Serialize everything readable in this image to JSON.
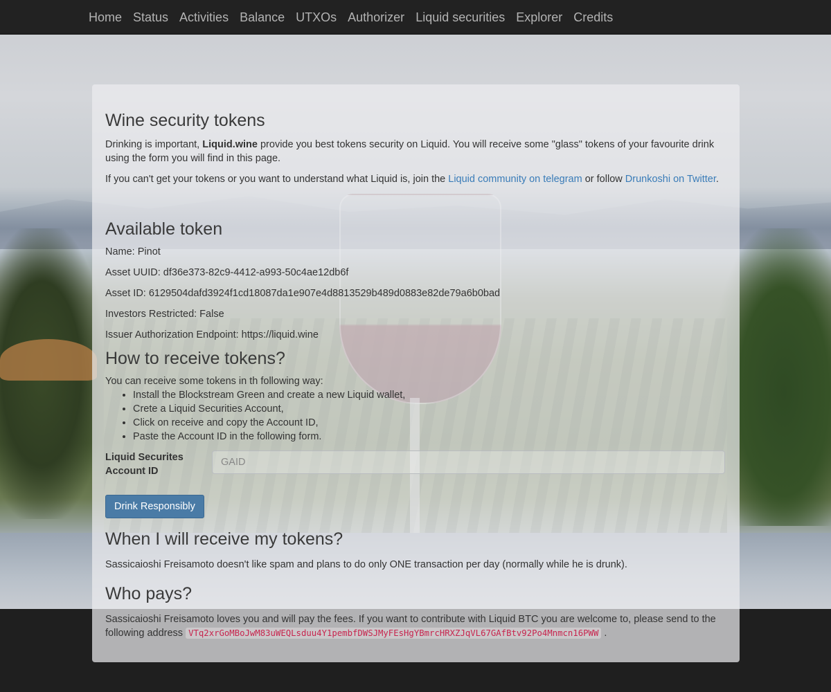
{
  "nav": {
    "items": [
      {
        "label": "Home"
      },
      {
        "label": "Status"
      },
      {
        "label": "Activities"
      },
      {
        "label": "Balance"
      },
      {
        "label": "UTXOs"
      },
      {
        "label": "Authorizer"
      },
      {
        "label": "Liquid securities"
      },
      {
        "label": "Explorer"
      },
      {
        "label": "Credits"
      }
    ]
  },
  "intro": {
    "title": "Wine security tokens",
    "p1_before": "Drinking is important, ",
    "p1_brand": "Liquid.wine",
    "p1_after": " provide you best tokens security on Liquid. You will receive some \"glass\" tokens of your favourite drink using the form you will find in this page.",
    "p2_before": "If you can't get your tokens or you want to understand what Liquid is, join the ",
    "p2_link1": "Liquid community on telegram",
    "p2_middle": " or follow ",
    "p2_link2": "Drunkoshi on Twitter",
    "p2_after": "."
  },
  "token": {
    "title": "Available token",
    "name": "Name: Pinot",
    "uuid": "Asset UUID: df36e373-82c9-4412-a993-50c4ae12db6f",
    "asset_id": "Asset ID: 6129504dafd3924f1cd18087da1e907e4d8813529b489d0883e82de79a6b0bad",
    "restricted": "Investors Restricted: False",
    "endpoint": "Issuer Authorization Endpoint: https://liquid.wine"
  },
  "how": {
    "title": "How to receive tokens?",
    "intro": "You can receive some tokens in th following way:",
    "steps": [
      "Install the Blockstream Green and create a new Liquid wallet,",
      "Crete a Liquid Securities Account,",
      "Click on receive and copy the Account ID,",
      "Paste the Account ID in the following form."
    ]
  },
  "form": {
    "label": "Liquid Securites Account ID",
    "placeholder": "GAID",
    "value": "",
    "submit_label": "Drink Responsibly"
  },
  "when": {
    "title": "When I will receive my tokens?",
    "text": "Sassicaioshi Freisamoto doesn't like spam and plans to do only ONE transaction per day (normally while he is drunk)."
  },
  "pays": {
    "title": "Who pays?",
    "text_before": "Sassicaioshi Freisamoto loves you and will pay the fees. If you want to contribute with Liquid BTC you are welcome to, please send to the following address ",
    "address": "VTq2xrGoMBoJwM83uWEQLsduu4Y1pembfDWSJMyFEsHgYBmrcHRXZJqVL67GAfBtv92Po4Mnmcn16PWW",
    "text_after": " ."
  },
  "colors": {
    "navbar_bg": "#222222",
    "nav_text": "#b3b3b3",
    "link": "#3a7cb8",
    "button_bg": "#4a7ba6",
    "code_text": "#c7254e"
  }
}
